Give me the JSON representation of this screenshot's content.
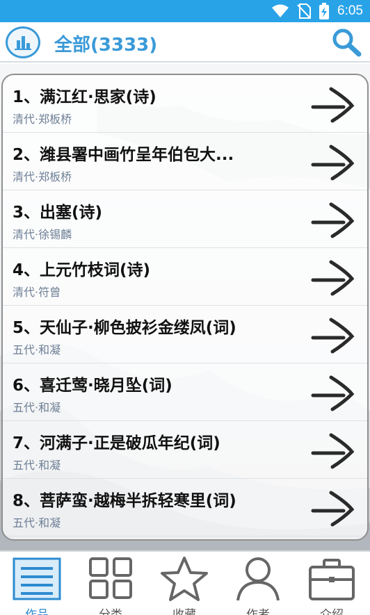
{
  "status_bar": {
    "time": "6:05",
    "icons": [
      "wifi-icon",
      "no-sim-icon",
      "battery-charging-icon"
    ]
  },
  "header": {
    "title": "全部(3333)",
    "left_icon": "chart-icon",
    "right_icon": "search-icon"
  },
  "list": {
    "items": [
      {
        "title": "1、满江红·思家(诗)",
        "subtitle": "清代·郑板桥"
      },
      {
        "title": "2、潍县署中画竹呈年伯包大...",
        "subtitle": "清代·郑板桥"
      },
      {
        "title": "3、出塞(诗)",
        "subtitle": "清代·徐锡麟"
      },
      {
        "title": "4、上元竹枝词(诗)",
        "subtitle": "清代·符曾"
      },
      {
        "title": "5、天仙子·柳色披衫金缕凤(词)",
        "subtitle": "五代·和凝"
      },
      {
        "title": "6、喜迁莺·晓月坠(词)",
        "subtitle": "五代·和凝"
      },
      {
        "title": "7、河满子·正是破瓜年纪(词)",
        "subtitle": "五代·和凝"
      },
      {
        "title": "8、菩萨蛮·越梅半拆轻寒里(词)",
        "subtitle": "五代·和凝"
      }
    ],
    "row_icon": "arrow-right-icon"
  },
  "bottom_nav": {
    "items": [
      {
        "label": "作品",
        "icon": "list-icon",
        "active": true
      },
      {
        "label": "分类",
        "icon": "grid-icon",
        "active": false
      },
      {
        "label": "收藏",
        "icon": "star-icon",
        "active": false
      },
      {
        "label": "作者",
        "icon": "person-icon",
        "active": false
      },
      {
        "label": "介绍",
        "icon": "briefcase-icon",
        "active": false
      }
    ]
  },
  "colors": {
    "status_bar": "#29a3e8",
    "accent": "#3a9ad8",
    "subtitle": "#6d7f95",
    "active_nav": "#2e8bd0"
  }
}
